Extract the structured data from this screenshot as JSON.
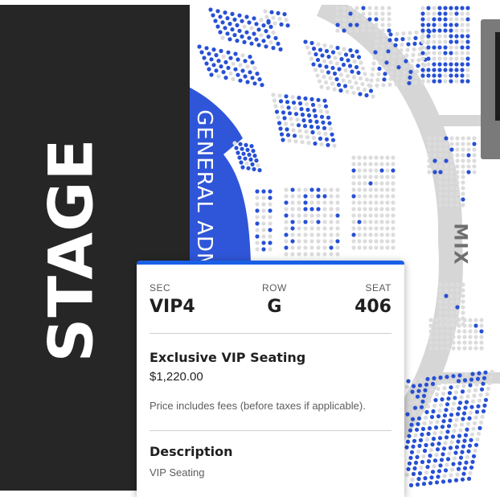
{
  "map": {
    "stage_label": "STAGE",
    "mix_label": "MIX",
    "ga_label": "GENERAL ADMISSION",
    "colors": {
      "stage": "#262626",
      "general_admission": "#2f56d8",
      "available_seat": "#2750d4",
      "unavailable_seat": "#dcdcdc",
      "aisle": "#d9d9d9"
    }
  },
  "popup": {
    "accent": "#1a5fe6",
    "section_label": "SEC",
    "section_value": "VIP4",
    "row_label": "ROW",
    "row_value": "G",
    "seat_label": "SEAT",
    "seat_value": "406",
    "ticket_type": "Exclusive VIP Seating",
    "price": "$1,220.00",
    "price_note": "Price includes fees (before taxes if applicable).",
    "description_title": "Description",
    "description_text": "VIP Seating"
  }
}
